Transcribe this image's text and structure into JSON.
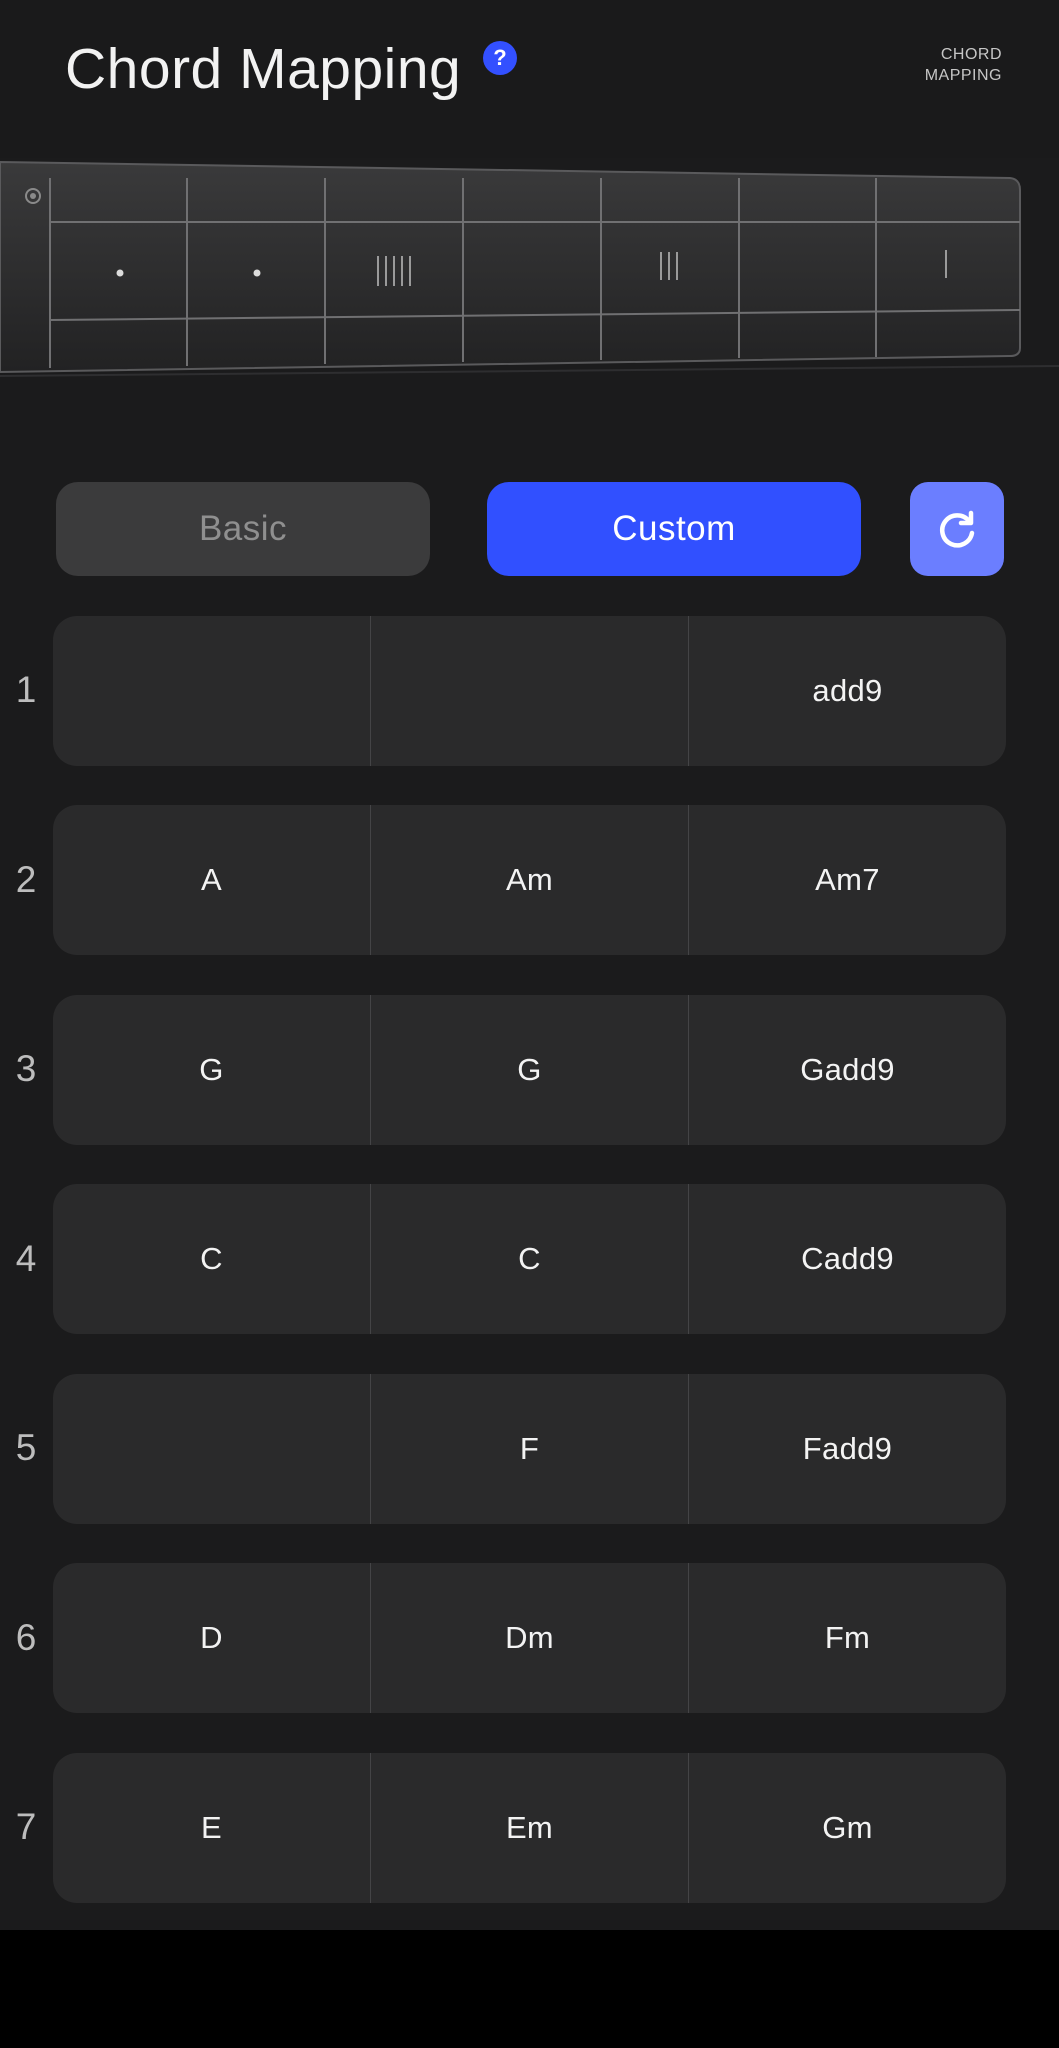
{
  "header": {
    "title": "Chord Mapping",
    "help_icon": "question-mark-icon",
    "mode_label": "CHORD\nMAPPING"
  },
  "fretboard": {
    "single_dot_frets": [
      1,
      2
    ],
    "frets_with_vertical_marks": [
      {
        "fret": 3,
        "marks": 5
      },
      {
        "fret": 5,
        "marks": 3
      },
      {
        "fret": 7,
        "marks": 1
      }
    ]
  },
  "mode_toggle": {
    "basic_label": "Basic",
    "custom_label": "Custom",
    "selected": "Custom",
    "reset_icon": "refresh-icon"
  },
  "rows": [
    {
      "number": "1",
      "chords": [
        "",
        "",
        "add9"
      ]
    },
    {
      "number": "2",
      "chords": [
        "A",
        "Am",
        "Am7"
      ]
    },
    {
      "number": "3",
      "chords": [
        "G",
        "G",
        "Gadd9"
      ]
    },
    {
      "number": "4",
      "chords": [
        "C",
        "C",
        "Cadd9"
      ]
    },
    {
      "number": "5",
      "chords": [
        "",
        "F",
        "Fadd9"
      ]
    },
    {
      "number": "6",
      "chords": [
        "D",
        "Dm",
        "Fm"
      ]
    },
    {
      "number": "7",
      "chords": [
        "E",
        "Em",
        "Gm"
      ]
    }
  ],
  "colors": {
    "accent": "#3150ff",
    "reset_button": "#6b7eff",
    "background": "#1b1b1c",
    "cell": "#2a2a2b"
  }
}
